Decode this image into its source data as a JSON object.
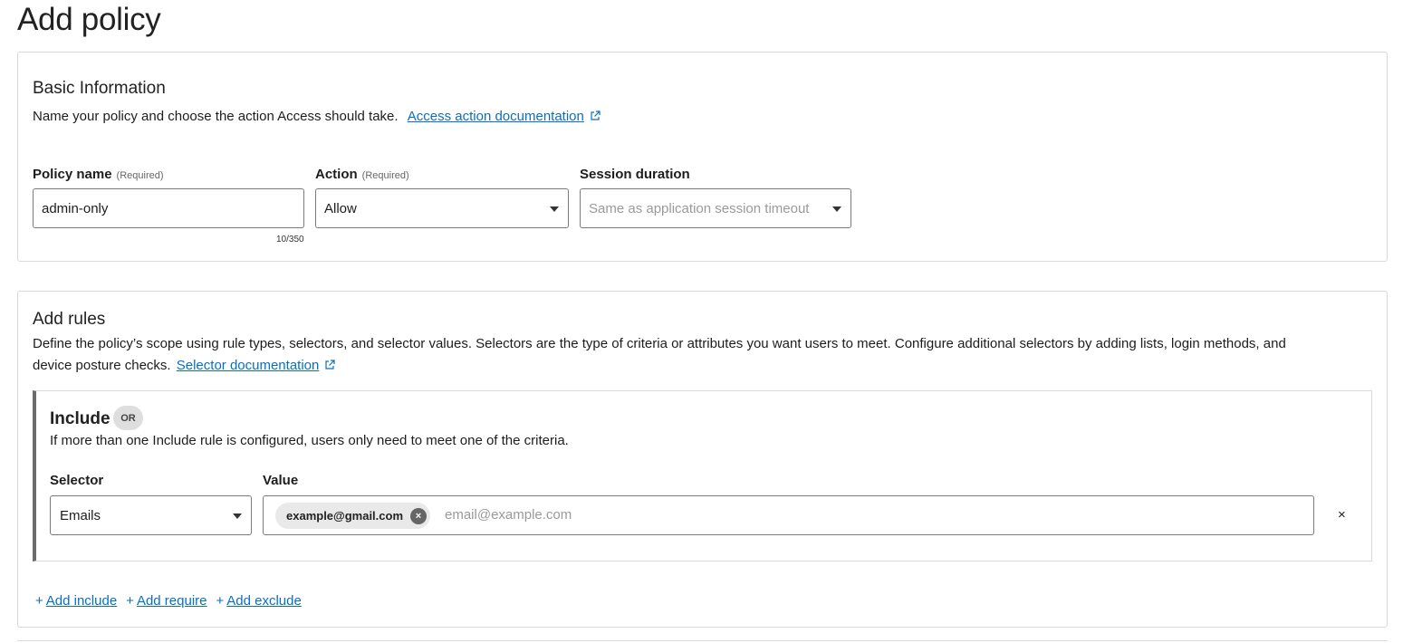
{
  "page": {
    "title": "Add policy"
  },
  "basic": {
    "title": "Basic Information",
    "description": "Name your policy and choose the action Access should take.",
    "doc_link": "Access action documentation",
    "policy_name": {
      "label": "Policy name",
      "required": "(Required)",
      "value": "admin-only",
      "counter": "10/350"
    },
    "action": {
      "label": "Action",
      "required": "(Required)",
      "value": "Allow"
    },
    "session": {
      "label": "Session duration",
      "placeholder": "Same as application session timeout"
    }
  },
  "rules": {
    "title": "Add rules",
    "description_line1": "Define the policy’s scope using rule types, selectors, and selector values. Selectors are the type of criteria or attributes you want users to meet. Configure additional selectors by adding lists, login methods, and",
    "description_line2": "device posture checks.",
    "doc_link": "Selector documentation",
    "include": {
      "title": "Include",
      "badge": "OR",
      "description": "If more than one Include rule is configured, users only need to meet one of the criteria.",
      "selector_label": "Selector",
      "value_label": "Value",
      "selector_value": "Emails",
      "chip": "example@gmail.com",
      "chip_remove": "×",
      "value_placeholder": "email@example.com",
      "remove_row": "×"
    },
    "add_links": {
      "plus": "+",
      "include": "Add include",
      "require": "Add require",
      "exclude": "Add exclude"
    }
  },
  "colors": {
    "link": "#0a6fc2",
    "border": "#d9d9d9",
    "rule_accent": "#6b6b6b"
  }
}
